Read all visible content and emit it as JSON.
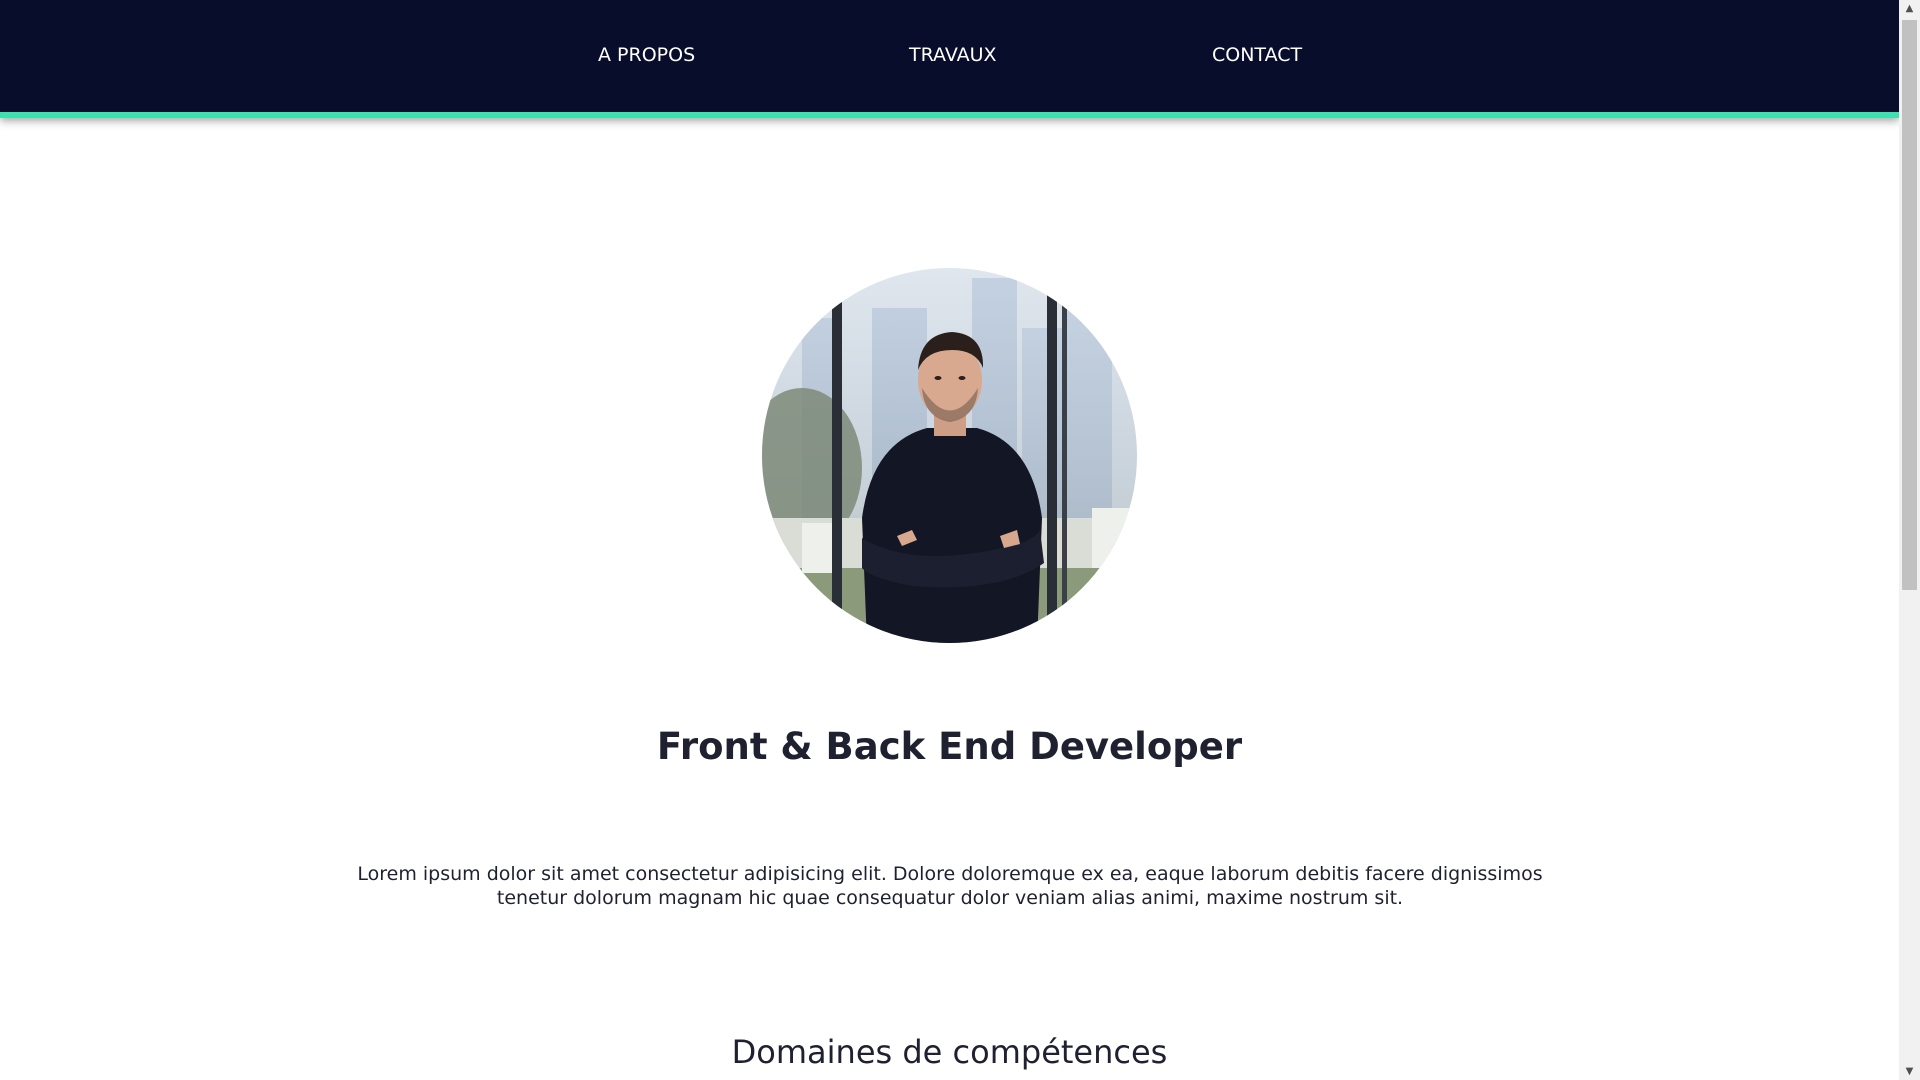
{
  "nav": {
    "items": [
      {
        "label": "A PROPOS"
      },
      {
        "label": "TRAVAUX"
      },
      {
        "label": "CONTACT"
      }
    ]
  },
  "hero": {
    "title": "Front & Back End Developer",
    "intro": "Lorem ipsum dolor sit amet consectetur adipisicing elit. Dolore doloremque ex ea, eaque laborum debitis facere dignissimos tenetur dolorum magnam hic quae consequatur dolor veniam alias animi, maxime nostrum sit."
  },
  "skills": {
    "heading": "Domaines de compétences"
  },
  "scrollbar": {
    "up_glyph": "▲",
    "down_glyph": "▼"
  },
  "colors": {
    "nav_background": "#080d2b",
    "nav_accent": "#3ee0b0",
    "text": "#1f2130"
  }
}
